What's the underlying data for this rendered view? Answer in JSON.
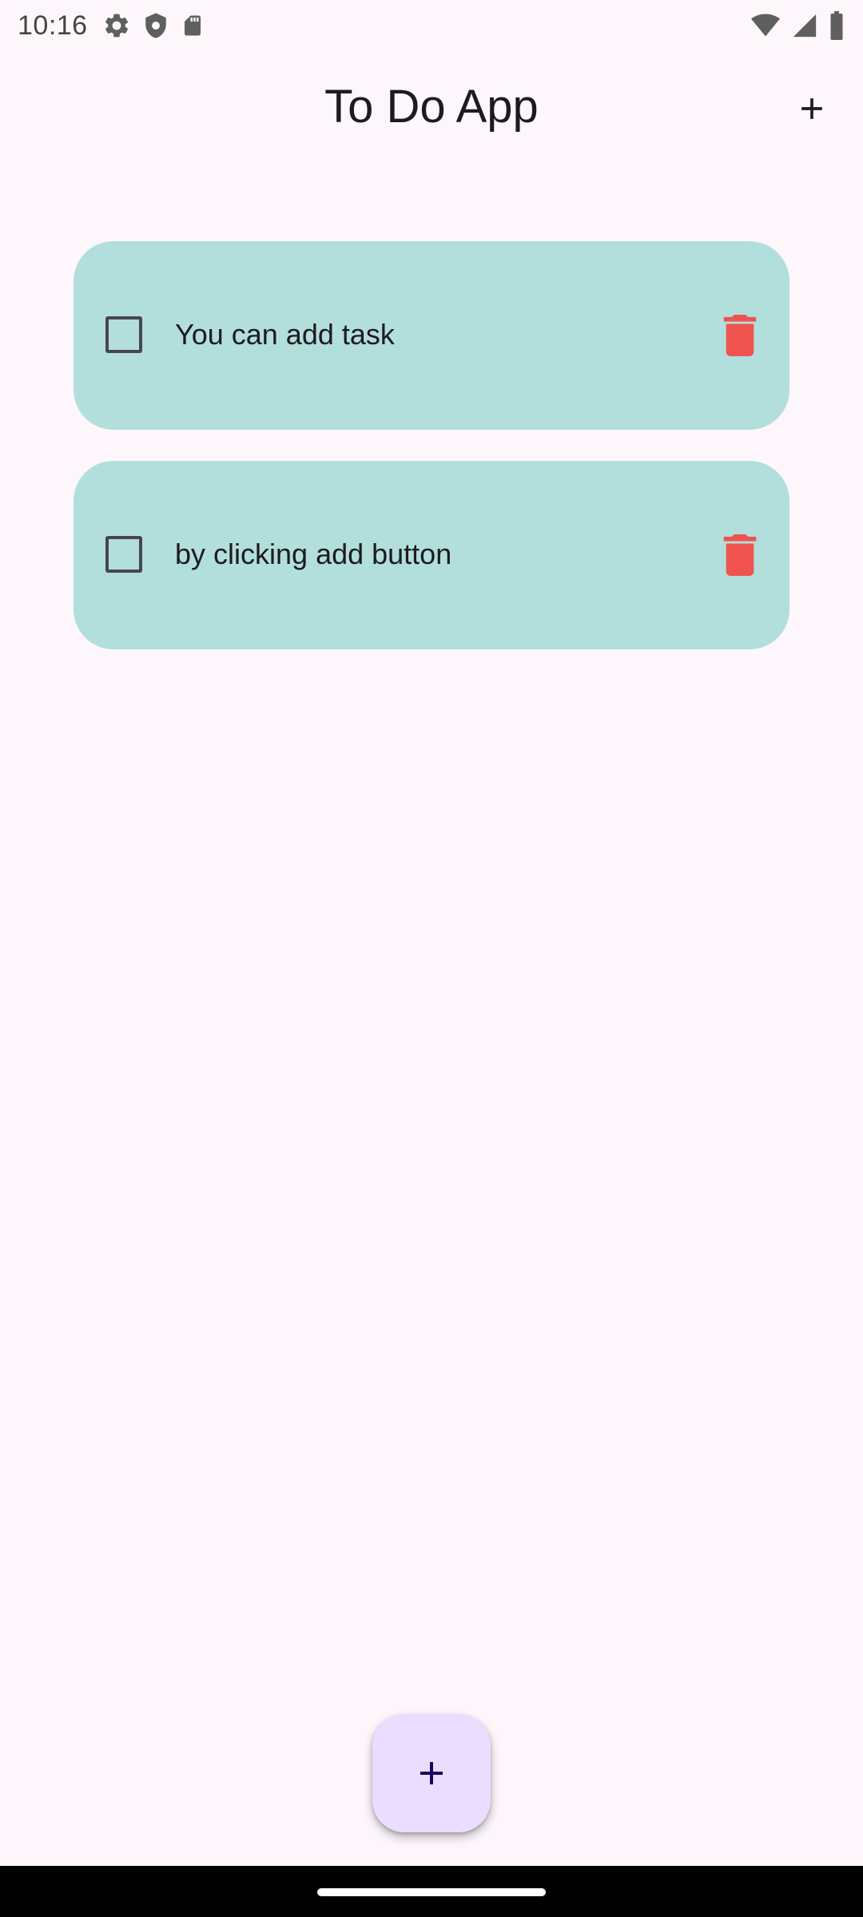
{
  "status_bar": {
    "time": "10:16",
    "left_icons": [
      "settings-icon",
      "shield-icon",
      "sd-card-icon"
    ],
    "right_icons": [
      "wifi-icon",
      "signal-icon",
      "battery-icon"
    ]
  },
  "app_bar": {
    "title": "To Do App",
    "action_icon": "add-icon"
  },
  "tasks": [
    {
      "text": "You can add task",
      "checked": false
    },
    {
      "text": "by clicking add button",
      "checked": false
    }
  ],
  "fab": {
    "icon": "add-icon"
  },
  "colors": {
    "background": "#fdf7fc",
    "card": "#b2dfdb",
    "delete": "#ef5350",
    "fab": "#eaddff",
    "fab_icon": "#21005d"
  }
}
